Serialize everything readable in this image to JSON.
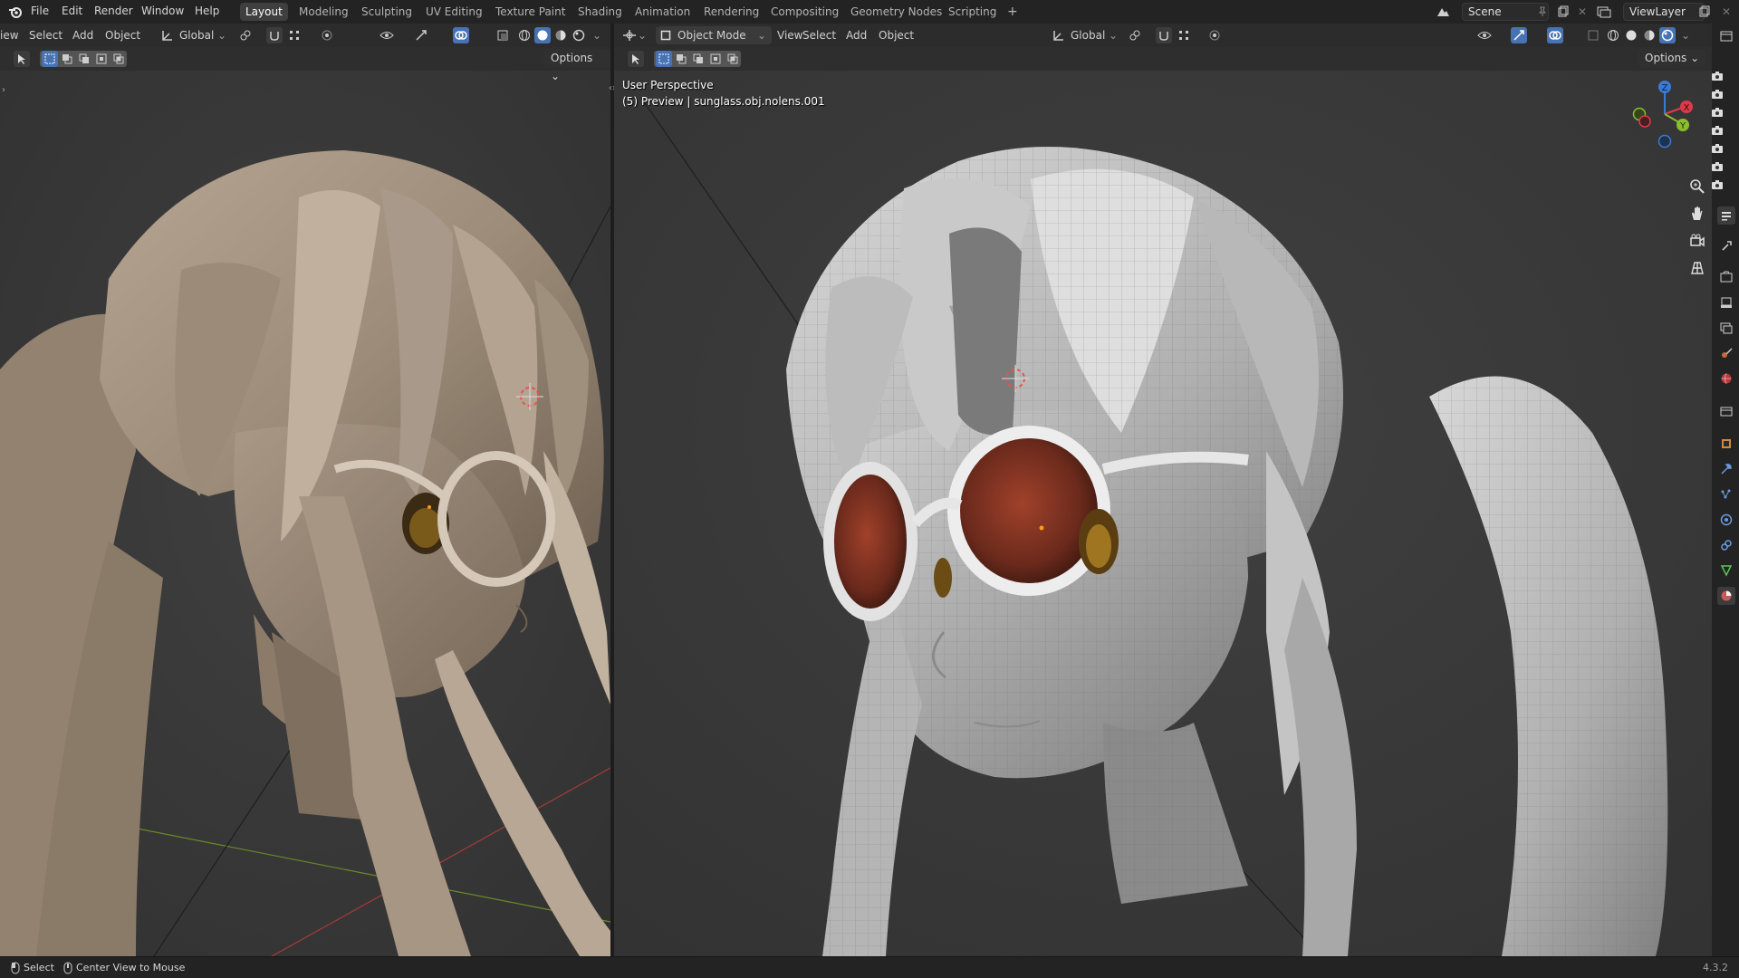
{
  "menubar": {
    "menus": [
      "File",
      "Edit",
      "Render",
      "Window",
      "Help"
    ],
    "workspaces": [
      "Layout",
      "Modeling",
      "Sculpting",
      "UV Editing",
      "Texture Paint",
      "Shading",
      "Animation",
      "Rendering",
      "Compositing",
      "Geometry Nodes",
      "Scripting"
    ],
    "add_tab": "+",
    "scene": "Scene",
    "view_layer": "ViewLayer"
  },
  "left_viewport": {
    "menus": [
      "iew",
      "Select",
      "Add",
      "Object"
    ],
    "transform_orientation": "Global",
    "options_label": "Options"
  },
  "right_viewport": {
    "mode": "Object Mode",
    "menus": [
      "View",
      "Select",
      "Add",
      "Object"
    ],
    "transform_orientation": "Global",
    "options_label": "Options",
    "perspective_label": "User Perspective",
    "object_label": "(5) Preview | sunglass.obj.nolens.001",
    "axes": {
      "z": "Z",
      "x": "X",
      "y": "Y"
    }
  },
  "statusbar": {
    "select_label": "Select",
    "center_label": "Center View to Mouse",
    "version": "4.3.2"
  },
  "colors": {
    "accent": "#4772b3",
    "x_axis": "#e03a4a",
    "y_axis": "#8bbd2d",
    "z_axis": "#3a7bd5",
    "viewport_bg": "#3b3b3b",
    "hair_brown": "#a39380"
  }
}
